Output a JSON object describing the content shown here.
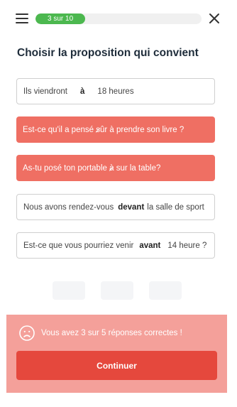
{
  "progress": {
    "label": "3 sur 10",
    "current": 3,
    "total": 10,
    "fraction": 0.3
  },
  "title": "Choisir la proposition qui convient",
  "options": [
    {
      "before": "Ils viendront",
      "answer": "à",
      "after": "18 heures",
      "state": "neutral"
    },
    {
      "before": "Est-ce qu'il a pensé ",
      "struck": "s",
      "rest": "ûr à prendre son livre ?",
      "state": "wrong"
    },
    {
      "before": "As-tu posé ton portable ",
      "struck": "à",
      "rest": " sur la table?",
      "state": "wrong"
    },
    {
      "before": "Nous avons rendez-vous",
      "answer": "devant",
      "after": "la salle de sport",
      "state": "neutral"
    },
    {
      "before": "Est-ce que vous pourriez venir",
      "answer": "avant",
      "after": "14 heure ?",
      "state": "neutral"
    }
  ],
  "feedback": {
    "message": "Vous avez 3 sur 5  réponses correctes !",
    "button_label": "Continuer"
  },
  "colors": {
    "progress": "#4cb84f",
    "wrong": "#ef6f63",
    "feedback_bg": "#f4a09a",
    "button": "#e5483d",
    "title": "#1e2c3a"
  },
  "icons": [
    "menu-icon",
    "close-icon",
    "sad-face-icon"
  ]
}
